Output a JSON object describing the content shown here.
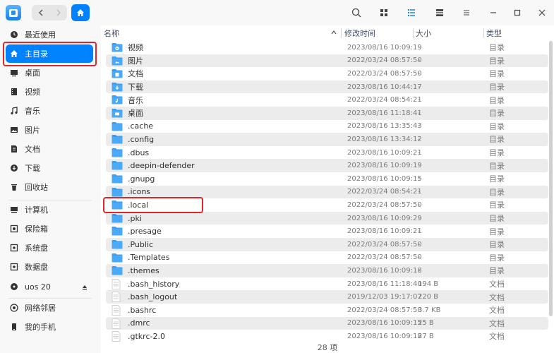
{
  "titlebar": {
    "icons": [
      "app-logo-icon",
      "back-icon",
      "forward-icon",
      "home-icon",
      "search-icon",
      "icon-view-icon",
      "list-view-icon",
      "detail-view-icon",
      "menu-icon",
      "minimize-icon",
      "maximize-icon",
      "close-icon"
    ],
    "active_view": "list"
  },
  "sidebar": {
    "items": [
      {
        "label": "最近使用",
        "icon": "clock-icon"
      },
      {
        "label": "主目录",
        "icon": "home-icon",
        "active": true
      },
      {
        "label": "桌面",
        "icon": "desktop-icon"
      },
      {
        "label": "视频",
        "icon": "video-icon"
      },
      {
        "label": "音乐",
        "icon": "music-icon"
      },
      {
        "label": "图片",
        "icon": "picture-icon"
      },
      {
        "label": "文档",
        "icon": "document-icon"
      },
      {
        "label": "下载",
        "icon": "download-icon"
      },
      {
        "label": "回收站",
        "icon": "trash-icon"
      },
      {
        "label": "计算机",
        "icon": "computer-icon"
      },
      {
        "label": "保险箱",
        "icon": "safe-icon"
      },
      {
        "label": "系统盘",
        "icon": "disk-icon"
      },
      {
        "label": "数据盘",
        "icon": "disk-icon"
      },
      {
        "label": "uos 20",
        "icon": "drive-icon"
      },
      {
        "label": "网络邻居",
        "icon": "network-icon"
      },
      {
        "label": "我的手机",
        "icon": "phone-icon"
      }
    ]
  },
  "columns": {
    "name": "名称",
    "modified": "修改时间",
    "size": "大小",
    "type": "类型"
  },
  "files": [
    {
      "name": "视频",
      "time": "2023/08/16 10:09:19",
      "size": "-",
      "type": "目录",
      "kind": "folder-video"
    },
    {
      "name": "图片",
      "time": "2022/03/24 08:57:50",
      "size": "-",
      "type": "目录",
      "kind": "folder-picture"
    },
    {
      "name": "文档",
      "time": "2022/03/24 08:57:50",
      "size": "-",
      "type": "目录",
      "kind": "folder-document"
    },
    {
      "name": "下载",
      "time": "2023/08/16 10:44:17",
      "size": "-",
      "type": "目录",
      "kind": "folder-download"
    },
    {
      "name": "音乐",
      "time": "2022/03/24 08:54:21",
      "size": "-",
      "type": "目录",
      "kind": "folder-music"
    },
    {
      "name": "桌面",
      "time": "2023/08/16 11:18:41",
      "size": "-",
      "type": "目录",
      "kind": "folder-desktop"
    },
    {
      "name": ".cache",
      "time": "2023/08/16 13:35:43",
      "size": "-",
      "type": "目录",
      "kind": "folder"
    },
    {
      "name": ".config",
      "time": "2023/08/16 13:34:12",
      "size": "-",
      "type": "目录",
      "kind": "folder"
    },
    {
      "name": ".dbus",
      "time": "2023/08/16 10:09:21",
      "size": "-",
      "type": "目录",
      "kind": "folder"
    },
    {
      "name": ".deepin-defender",
      "time": "2023/08/16 10:09:19",
      "size": "-",
      "type": "目录",
      "kind": "folder"
    },
    {
      "name": ".gnupg",
      "time": "2023/08/16 10:09:15",
      "size": "-",
      "type": "目录",
      "kind": "folder"
    },
    {
      "name": ".icons",
      "time": "2022/03/24 08:54:21",
      "size": "-",
      "type": "目录",
      "kind": "folder"
    },
    {
      "name": ".local",
      "time": "2022/03/24 08:57:50",
      "size": "-",
      "type": "目录",
      "kind": "folder"
    },
    {
      "name": ".pki",
      "time": "2023/08/16 10:09:29",
      "size": "-",
      "type": "目录",
      "kind": "folder"
    },
    {
      "name": ".presage",
      "time": "2023/08/16 10:09:21",
      "size": "-",
      "type": "目录",
      "kind": "folder"
    },
    {
      "name": ".Public",
      "time": "2022/03/24 08:57:50",
      "size": "-",
      "type": "目录",
      "kind": "folder"
    },
    {
      "name": ".Templates",
      "time": "2022/03/24 08:57:50",
      "size": "-",
      "type": "目录",
      "kind": "folder"
    },
    {
      "name": ".themes",
      "time": "2023/08/16 10:09:18",
      "size": "-",
      "type": "目录",
      "kind": "folder"
    },
    {
      "name": ".bash_history",
      "time": "2023/08/16 11:18:40",
      "size": "194 B",
      "type": "文档",
      "kind": "file"
    },
    {
      "name": ".bash_logout",
      "time": "2019/12/03 19:17:07",
      "size": "220 B",
      "type": "文档",
      "kind": "file"
    },
    {
      "name": ".bashrc",
      "time": "2022/03/24 08:57:50",
      "size": "3.7 KB",
      "type": "文档",
      "kind": "file"
    },
    {
      "name": ".dmrc",
      "time": "2023/08/16 10:09:15",
      "size": "25 B",
      "type": "文档",
      "kind": "file"
    },
    {
      "name": ".gtkrc-2.0",
      "time": "2023/08/16 10:09:18",
      "size": "27 B",
      "type": "文档",
      "kind": "file"
    }
  ],
  "status": {
    "count": "28 项"
  },
  "colors": {
    "accent": "#0081ff",
    "highlight": "#e0262a",
    "folder": "#3a9ff5"
  }
}
